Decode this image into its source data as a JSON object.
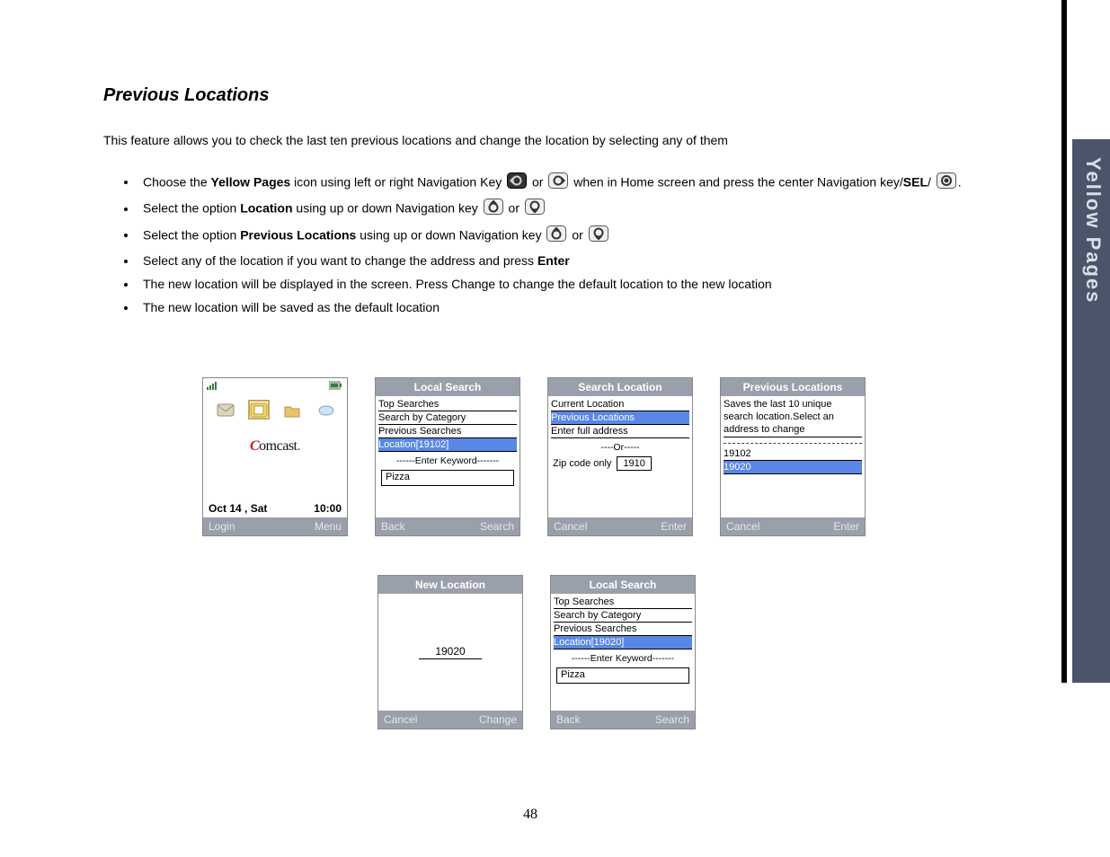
{
  "sideTab": "Yellow Pages",
  "title": "Previous Locations",
  "intro": "This feature allows you to check the last ten previous locations and change the location by selecting any of them",
  "steps": {
    "s1a": "Choose the ",
    "s1b": "Yellow Pages",
    "s1c": " icon using left or right Navigation Key ",
    "s1or": " or ",
    "s1d": "  when in Home screen and press the center Navigation key/",
    "s1e": "SEL",
    "s1f": "/",
    "s1g": ".",
    "s2a": "Select the option ",
    "s2b": "Location",
    "s2c": " using up or down Navigation key ",
    "s3a": "Select the option ",
    "s3b": "Previous Locations",
    "s3c": " using up or down Navigation key ",
    "s4a": "Select any of the location if you want to change the address and press ",
    "s4b": "Enter",
    "s5": "The new location will be displayed in the screen. Press Change to change the default location to the  new location",
    "s6": "The new location will be saved as the default location"
  },
  "home": {
    "date": "Oct 14 , Sat",
    "time": "10:00",
    "softLeft": "Login",
    "softRight": "Menu",
    "brandPrefix": "C",
    "brandRest": "omcast"
  },
  "localSearch1": {
    "title": "Local Search",
    "items": [
      "Top Searches",
      "Search by Category",
      "Previous Searches"
    ],
    "sel": "Location[19102]",
    "hint": "------Enter Keyword-------",
    "input": "Pizza",
    "softLeft": "Back",
    "softRight": "Search"
  },
  "searchLocation": {
    "title": "Search Location",
    "items": [
      "Current Location"
    ],
    "sel": "Previous Locations",
    "items2": [
      "Enter full address"
    ],
    "orHint": "----Or-----",
    "zipLabel": "Zip code only",
    "zipValue": "1910",
    "softLeft": "Cancel",
    "softRight": "Enter"
  },
  "prevLocations": {
    "title": "Previous Locations",
    "desc": "Saves the last 10 unique search location.Select an address to change",
    "item1": "19102",
    "sel": "19020",
    "softLeft": "Cancel",
    "softRight": "Enter"
  },
  "newLocation": {
    "title": "New  Location",
    "value": "19020",
    "softLeft": "Cancel",
    "softRight": "Change"
  },
  "localSearch2": {
    "title": "Local Search",
    "items": [
      "Top Searches",
      "Search by Category",
      "Previous Searches"
    ],
    "sel": "Location[19020]",
    "hint": "------Enter Keyword-------",
    "input": "Pizza",
    "softLeft": "Back",
    "softRight": "Search"
  },
  "pageNumber": "48"
}
